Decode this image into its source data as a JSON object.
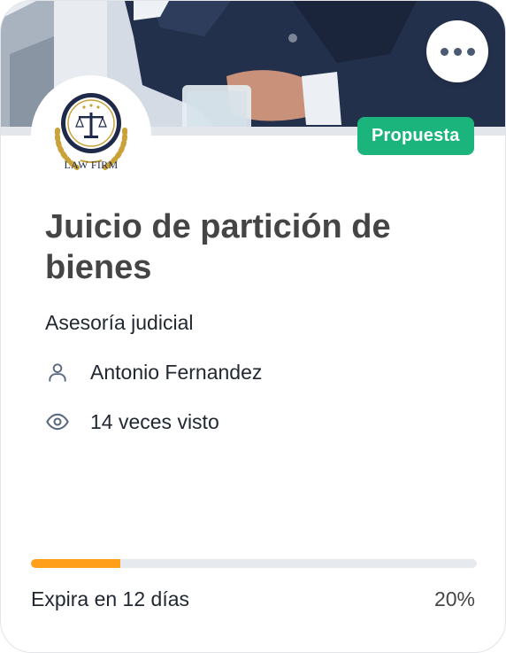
{
  "card": {
    "title": "Juicio de partición de bienes",
    "category": "Asesoría judicial",
    "status": "Propuesta",
    "owner": "Antonio Fernandez",
    "views": "14 veces visto",
    "expires": "Expira en 12 días",
    "progress_label": "20%",
    "progress_value": 0.2
  },
  "logo": {
    "text": "LAW FIRM"
  },
  "icons": {
    "more": "more-horizontal-icon",
    "owner": "user-icon",
    "views": "eye-icon"
  },
  "colors": {
    "status_badge": "#1ab47c",
    "progress_fill": "#ff9f1a",
    "progress_track": "#e6e9ee",
    "title_text": "#454545",
    "body_text": "#222831",
    "icon": "#5a6a80"
  }
}
